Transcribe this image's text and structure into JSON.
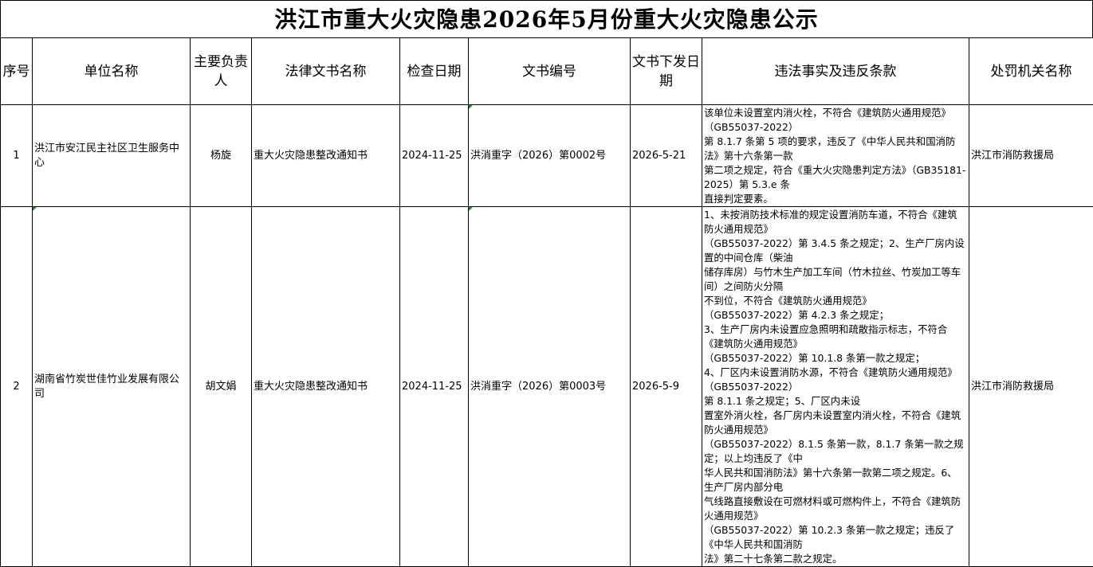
{
  "title": "洪江市重大火灾隐患2026年5月份重大火灾隐患公示",
  "headers": {
    "seq": "序号",
    "unit": "单位名称",
    "person": "主要负责人",
    "doc_name": "法律文书名称",
    "check_date": "检查日期",
    "doc_no": "文书编号",
    "issue_date": "文书下发日期",
    "violation": "违法事实及违反条款",
    "authority": "处罚机关名称"
  },
  "rows": [
    {
      "seq": "1",
      "unit": "洪江市安江民主社区卫生服务中心",
      "person": "杨旋",
      "doc_name": "重大火灾隐患整改通知书",
      "check_date": "2024-11-25",
      "doc_no": "洪消重字（2026）第0002号",
      "issue_date": "2026-5-21",
      "violation": "该单位未设置室内消火栓，不符合《建筑防火通用规范》（GB55037-2022）\n第 8.1.7 条第 5 项的要求，违反了《中华人民共和国消防法》第十六条第一款\n第二项之规定，符合《重大火灾隐患判定方法》（GB35181-2025）第 5.3.e 条\n直接判定要素。",
      "authority": "洪江市消防救援局"
    },
    {
      "seq": "2",
      "unit": "湖南省竹炭世佳竹业发展有限公司",
      "person": "胡文娟",
      "doc_name": "重大火灾隐患整改通知书",
      "check_date": "2024-11-25",
      "doc_no": "洪消重字（2026）第0003号",
      "issue_date": "2026-5-9",
      "violation": "1、未按消防技术标准的规定设置消防车道，不符合《建筑防火通用规范》\n（GB55037-2022）第 3.4.5 条之规定；2、生产厂房内设置的中间仓库（柴油\n储存库房）与竹木生产加工车间（竹木拉丝、竹炭加工等车间）之间防火分隔\n不到位，不符合《建筑防火通用规范》\n（GB55037-2022）第 4.2.3 条之规定；\n3、生产厂房内未设置应急照明和疏散指示标志，不符合《建筑防火通用规范》\n（GB55037-2022）第 10.1.8 条第一款之规定；\n4、厂区内未设置消防水源，不符合《建筑防火通用规范》（GB55037-2022）\n第 8.1.1 条之规定；5、厂区内未设\n置室外消火栓，各厂房内未设置室内消火栓，不符合《建筑防火通用规范》\n（GB55037-2022）8.1.5 条第一款，8.1.7 条第一款之规定；以上均违反了《中\n华人民共和国消防法》第十六条第一款第二项之规定。6、生产厂房内部分电\n气线路直接敷设在可燃材料或可燃构件上，不符合《建筑防火通用规范》\n（GB55037-2022）第 10.2.3 条第一款之规定；违反了《中华人民共和国消防\n法》第二十七条第二款之规定。",
      "authority": "洪江市消防救援局"
    }
  ]
}
